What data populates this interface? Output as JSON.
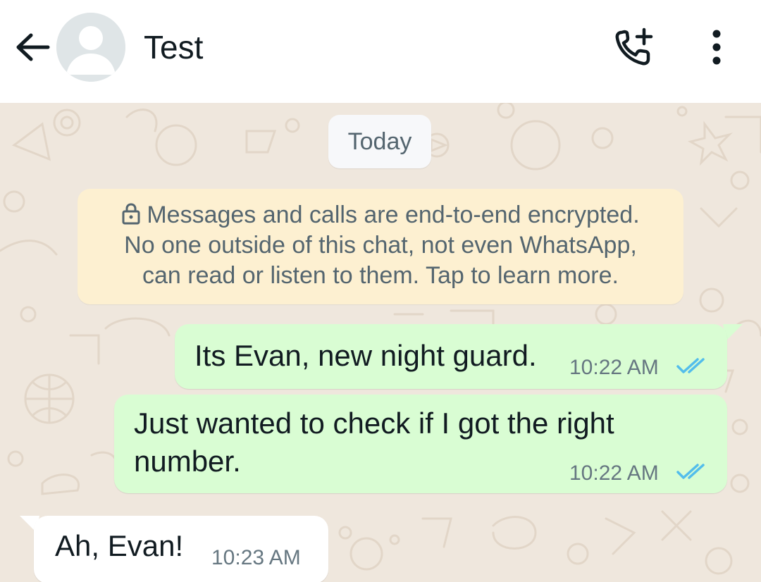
{
  "header": {
    "contact_name": "Test",
    "icons": {
      "back": "arrow-left-icon",
      "avatar": "default-avatar",
      "call": "add-call-icon",
      "menu": "more-vertical-icon"
    }
  },
  "chat": {
    "date_label": "Today",
    "encryption_notice": {
      "line1": "Messages and calls are end-to-end encrypted.",
      "line2": "No one outside of this chat, not even WhatsApp,",
      "line3": "can read or listen to them. Tap to learn more.",
      "icon": "lock-icon"
    },
    "messages": [
      {
        "direction": "outgoing",
        "text": "Its Evan, new night guard.",
        "time": "10:22 AM",
        "status": "read"
      },
      {
        "direction": "outgoing",
        "text_line1": "Just wanted to check if I got the right",
        "text_line2": "number.",
        "time": "10:22 AM",
        "status": "read"
      },
      {
        "direction": "incoming",
        "text": "Ah, Evan!",
        "time": "10:23 AM"
      }
    ]
  },
  "colors": {
    "outgoing_bubble": "#d9fdd3",
    "incoming_bubble": "#ffffff",
    "notice_bg": "#fdf0d1",
    "read_ticks": "#53bdeb",
    "wallpaper": "#efe7dd"
  }
}
